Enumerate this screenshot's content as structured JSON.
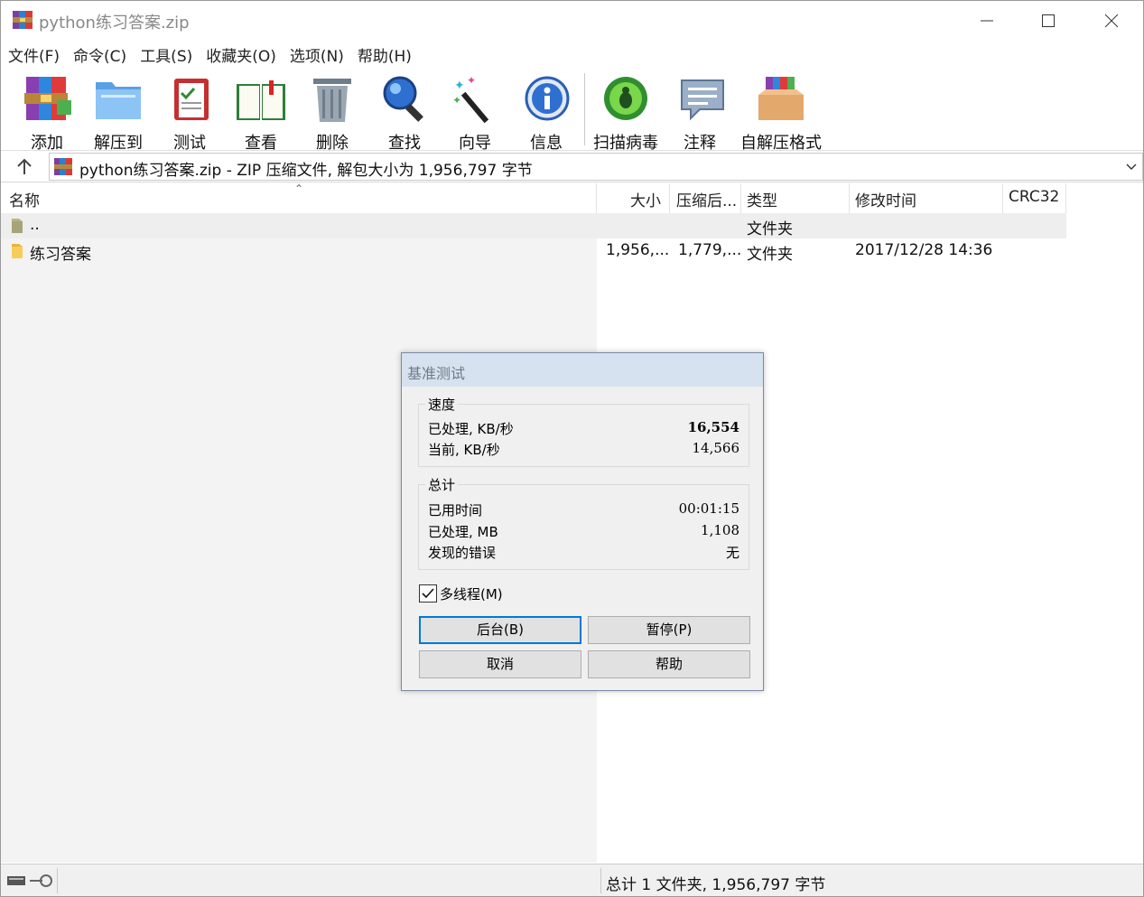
{
  "window": {
    "title": "python练习答案.zip"
  },
  "menu": [
    "文件(F)",
    "命令(C)",
    "工具(S)",
    "收藏夹(O)",
    "选项(N)",
    "帮助(H)"
  ],
  "toolbar": {
    "items": [
      {
        "label": "添加",
        "icon": "add-archive-icon"
      },
      {
        "label": "解压到",
        "icon": "extract-folder-icon"
      },
      {
        "label": "测试",
        "icon": "test-clipboard-icon"
      },
      {
        "label": "查看",
        "icon": "view-book-icon"
      },
      {
        "label": "删除",
        "icon": "trash-icon"
      },
      {
        "label": "查找",
        "icon": "magnifier-icon"
      },
      {
        "label": "向导",
        "icon": "wizard-wand-icon"
      },
      {
        "label": "信息",
        "icon": "info-icon"
      },
      {
        "label": "扫描病毒",
        "icon": "virus-scan-icon"
      },
      {
        "label": "注释",
        "icon": "comment-icon"
      },
      {
        "label": "自解压格式",
        "icon": "sfx-box-icon"
      }
    ]
  },
  "address": {
    "text": "python练习答案.zip - ZIP 压缩文件, 解包大小为 1,956,797 字节"
  },
  "columns": [
    "名称",
    "大小",
    "压缩后...",
    "类型",
    "修改时间",
    "CRC32"
  ],
  "rows": [
    {
      "name": "..",
      "size": "",
      "packed": "",
      "type": "文件夹",
      "modified": "",
      "crc": ""
    },
    {
      "name": "练习答案",
      "size": "1,956,...",
      "packed": "1,779,...",
      "type": "文件夹",
      "modified": "2017/12/28 14:36",
      "crc": ""
    }
  ],
  "status": {
    "text": "总计 1 文件夹, 1,956,797 字节"
  },
  "dialog": {
    "title": "基准测试",
    "speed": {
      "title": "速度",
      "processed_label": "已处理, KB/秒",
      "processed_value": "16,554",
      "current_label": "当前, KB/秒",
      "current_value": "14,566"
    },
    "total": {
      "title": "总计",
      "elapsed_label": "已用时间",
      "elapsed_value": "00:01:15",
      "processed_label": "已处理, MB",
      "processed_value": "1,108",
      "errors_label": "发现的错误",
      "errors_value": "无"
    },
    "multithread_label": "多线程(M)",
    "multithread_checked": true,
    "buttons": {
      "background": "后台(B)",
      "pause": "暂停(P)",
      "cancel": "取消",
      "help": "帮助"
    }
  },
  "colors": {
    "accent": "#0078d7",
    "dialog_title_bg": "#d6e2ef"
  }
}
